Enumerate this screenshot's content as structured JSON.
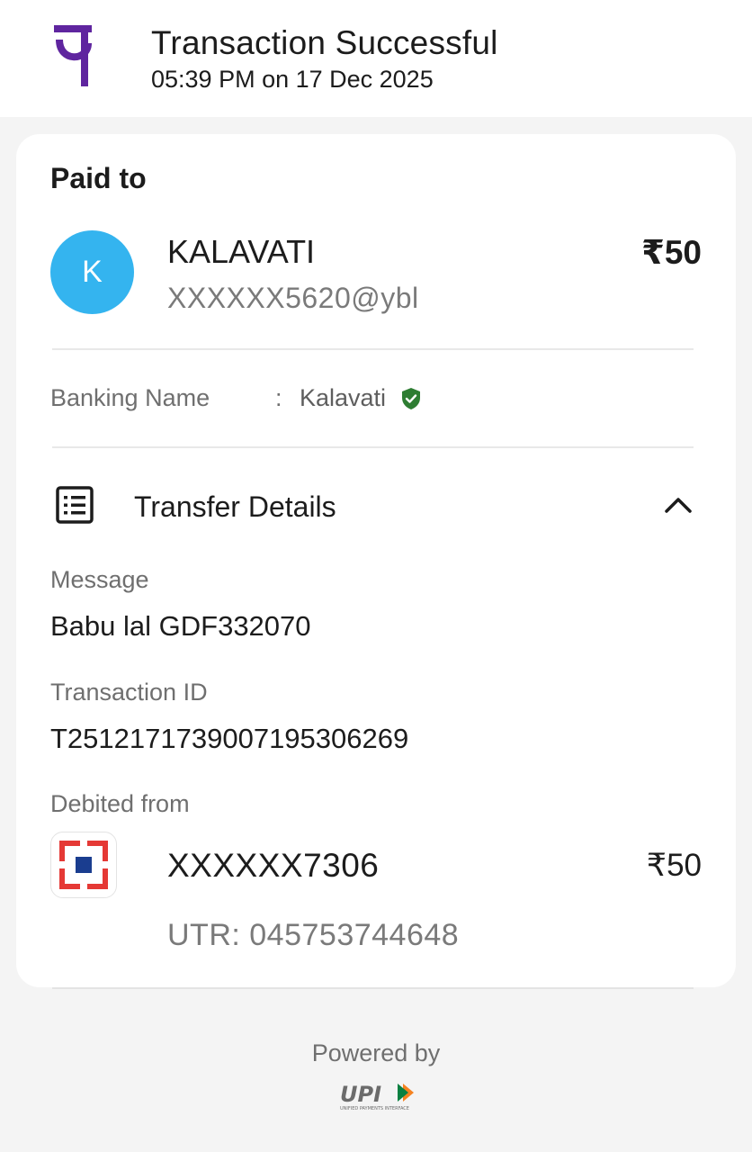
{
  "header": {
    "title": "Transaction Successful",
    "datetime": "05:39 PM on 17 Dec 2025",
    "app_logo": "pe-logo-icon"
  },
  "payee": {
    "section_title": "Paid to",
    "avatar_letter": "K",
    "name": "KALAVATI",
    "vpa": "XXXXXX5620@ybl",
    "amount": "₹50",
    "banking_name_label": "Banking Name",
    "banking_name_separator": ":",
    "banking_name_value": "Kalavati",
    "verified_icon": "verified-shield-icon"
  },
  "transfer_details": {
    "label": "Transfer Details",
    "message_label": "Message",
    "message_value": "Babu lal GDF332070",
    "transaction_id_label": "Transaction ID",
    "transaction_id_value": "T2512171739007195306269",
    "debited_from_label": "Debited from",
    "account_number": "XXXXXX7306",
    "account_amount": "₹50",
    "utr": "UTR: 045753744648"
  },
  "footer": {
    "powered_by": "Powered by",
    "upi_logo_text": "UPI",
    "upi_tagline": "UNIFIED PAYMENTS INTERFACE"
  },
  "colors": {
    "brand_purple": "#5f259f",
    "avatar_blue": "#34b4ef",
    "verified_green": "#2e7d32",
    "bank_red": "#e53935",
    "bank_blue": "#1a3d8f"
  }
}
